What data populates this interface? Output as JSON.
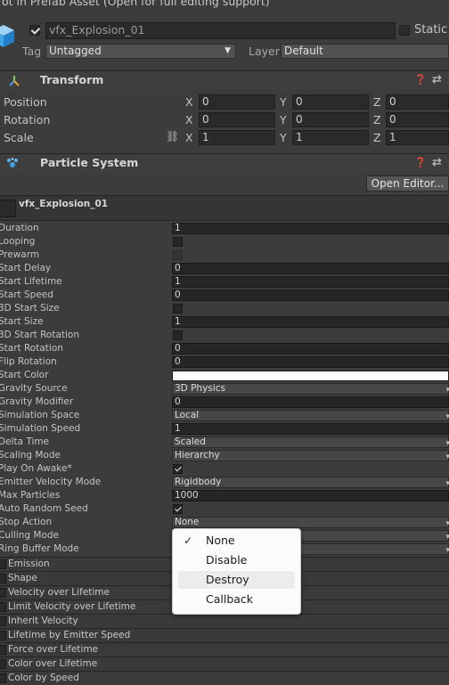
{
  "banner": "ot in Prefab Asset (Open for full editing support)",
  "header": {
    "object_name": "vfx_Explosion_01",
    "static_label": "Static",
    "tag_label": "Tag",
    "tag_value": "Untagged",
    "layer_label": "Layer",
    "layer_value": "Default"
  },
  "transform": {
    "title": "Transform",
    "rows": [
      {
        "label": "Position",
        "x": "0",
        "y": "0",
        "z": "0"
      },
      {
        "label": "Rotation",
        "x": "0",
        "y": "0",
        "z": "0"
      },
      {
        "label": "Scale",
        "x": "1",
        "y": "1",
        "z": "1"
      }
    ],
    "axis": {
      "x": "X",
      "y": "Y",
      "z": "Z"
    }
  },
  "particle_system": {
    "title": "Particle System",
    "open_editor": "Open Editor...",
    "system_name": "vfx_Explosion_01",
    "rows": [
      {
        "name": "Duration",
        "kind": "field",
        "value": "1"
      },
      {
        "name": "Looping",
        "kind": "check",
        "value": ""
      },
      {
        "name": "Prewarm",
        "kind": "check-dim",
        "value": ""
      },
      {
        "name": "Start Delay",
        "kind": "field",
        "value": "0"
      },
      {
        "name": "Start Lifetime",
        "kind": "field",
        "value": "1"
      },
      {
        "name": "Start Speed",
        "kind": "field",
        "value": "0"
      },
      {
        "name": "3D Start Size",
        "kind": "check",
        "value": ""
      },
      {
        "name": "Start Size",
        "kind": "field",
        "value": "1"
      },
      {
        "name": "3D Start Rotation",
        "kind": "check",
        "value": ""
      },
      {
        "name": "Start Rotation",
        "kind": "field",
        "value": "0"
      },
      {
        "name": "Flip Rotation",
        "kind": "field",
        "value": "0"
      },
      {
        "name": "Start Color",
        "kind": "color",
        "value": ""
      },
      {
        "name": "Gravity Source",
        "kind": "dropdown",
        "value": "3D Physics"
      },
      {
        "name": "Gravity Modifier",
        "kind": "field",
        "value": "0"
      },
      {
        "name": "Simulation Space",
        "kind": "dropdown",
        "value": "Local"
      },
      {
        "name": "Simulation Speed",
        "kind": "field",
        "value": "1"
      },
      {
        "name": "Delta Time",
        "kind": "dropdown",
        "value": "Scaled"
      },
      {
        "name": "Scaling Mode",
        "kind": "dropdown",
        "value": "Hierarchy"
      },
      {
        "name": "Play On Awake*",
        "kind": "check-on",
        "value": ""
      },
      {
        "name": "Emitter Velocity Mode",
        "kind": "dropdown",
        "value": "Rigidbody"
      },
      {
        "name": "Max Particles",
        "kind": "field",
        "value": "1000"
      },
      {
        "name": "Auto Random Seed",
        "kind": "check-on",
        "value": ""
      },
      {
        "name": "Stop Action",
        "kind": "dropdown",
        "value": "None"
      },
      {
        "name": "Culling Mode",
        "kind": "dropdown",
        "value": ""
      },
      {
        "name": "Ring Buffer Mode",
        "kind": "dropdown",
        "value": ""
      }
    ],
    "modules": [
      "Emission",
      "Shape",
      "Velocity over Lifetime",
      "Limit Velocity over Lifetime",
      "Inherit Velocity",
      "Lifetime by Emitter Speed",
      "Force over Lifetime",
      "Color over Lifetime",
      "Color by Speed"
    ]
  },
  "stop_action_menu": {
    "options": [
      "None",
      "Disable",
      "Destroy",
      "Callback"
    ],
    "selected": "None",
    "highlighted": "Destroy"
  },
  "icons": [
    "cube-icon",
    "transform-icon",
    "particle-system-icon",
    "help-icon",
    "preset-icon",
    "link-scale-icon",
    "checkmark-icon"
  ]
}
